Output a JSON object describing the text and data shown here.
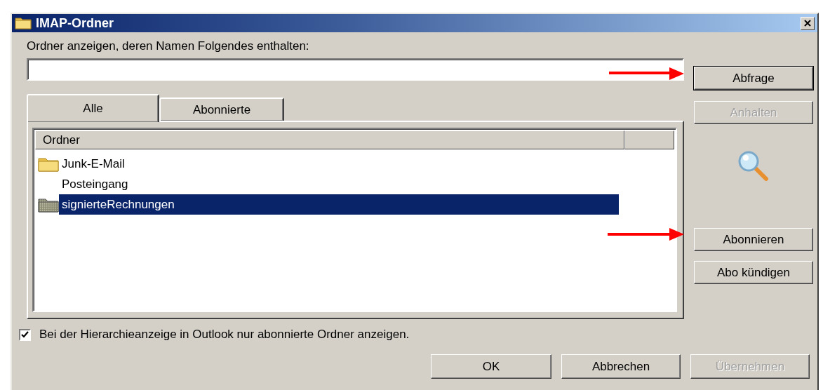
{
  "window": {
    "title": "IMAP-Ordner"
  },
  "filter_label": "Ordner anzeigen, deren Namen Folgendes enthalten:",
  "query_buttons": [
    {
      "label": "Abfrage",
      "disabled": false,
      "default": true
    },
    {
      "label": "Anhalten",
      "disabled": true,
      "default": false
    }
  ],
  "subscribe_buttons": [
    {
      "label": "Abonnieren",
      "disabled": false,
      "default": false
    },
    {
      "label": "Abo kündigen",
      "disabled": false,
      "default": false
    }
  ],
  "tabs": [
    {
      "label": "Alle",
      "selected": true
    },
    {
      "label": "Abonnierte",
      "selected": false
    }
  ],
  "table": {
    "columns": [
      "Ordner"
    ],
    "rows": [
      {
        "name": "Junk-E-Mail",
        "kind": "folder",
        "selected": false
      },
      {
        "name": "Posteingang",
        "kind": "plain",
        "selected": false
      },
      {
        "name": "signierteRechnungen",
        "kind": "subscribed",
        "selected": true
      }
    ]
  },
  "checkbox": {
    "label": "Bei der Hierarchieanzeige in Outlook nur abonnierte Ordner anzeigen.",
    "checked": true
  },
  "buttons": [
    {
      "label": "OK",
      "disabled": false,
      "default": false
    },
    {
      "label": "Abbrechen",
      "disabled": false,
      "default": false
    },
    {
      "label": "Übernehmen",
      "disabled": true,
      "default": false
    }
  ]
}
